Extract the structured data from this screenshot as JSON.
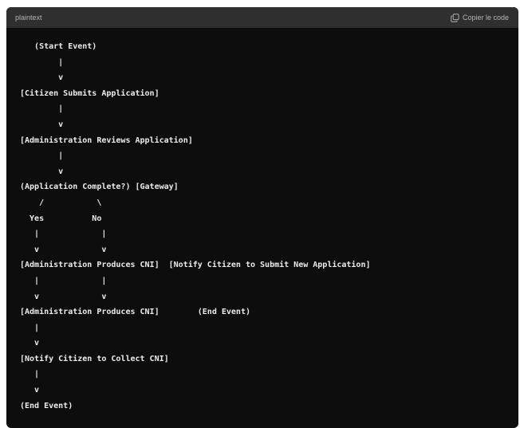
{
  "header": {
    "language": "plaintext",
    "copy_label": "Copier le code",
    "copy_icon": "copy-icon"
  },
  "code": {
    "lines": [
      "   (Start Event)",
      "        |",
      "        v",
      "[Citizen Submits Application]",
      "        |",
      "        v",
      "[Administration Reviews Application]",
      "        |",
      "        v",
      "(Application Complete?) [Gateway]",
      "    /           \\",
      "  Yes          No",
      "   |             |",
      "   v             v",
      "[Administration Produces CNI]  [Notify Citizen to Submit New Application]",
      "   |             |",
      "   v             v",
      "[Administration Produces CNI]        (End Event)",
      "   |",
      "   v",
      "[Notify Citizen to Collect CNI]",
      "   |",
      "   v",
      "(End Event)"
    ]
  },
  "colors": {
    "code_background": "#0d0d0d",
    "header_background": "#2f2f2f",
    "code_text": "#ececec",
    "header_text": "#b4b4b4"
  }
}
